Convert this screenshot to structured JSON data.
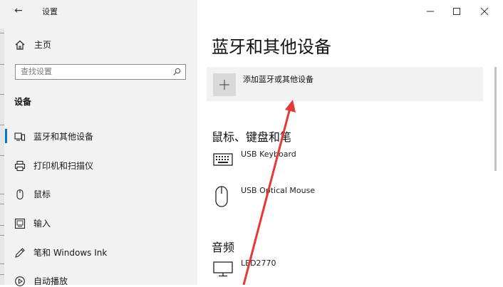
{
  "window": {
    "title": "设置",
    "controls": [
      "minimize-icon",
      "maximize-icon",
      "close-icon"
    ]
  },
  "sidebar": {
    "home_label": "主页",
    "search": {
      "placeholder": "查找设置",
      "icon": "search-icon"
    },
    "section_title": "设备",
    "items": [
      {
        "label": "蓝牙和其他设备",
        "icon": "bluetooth-devices-icon",
        "active": true
      },
      {
        "label": "打印机和扫描仪",
        "icon": "printer-icon",
        "active": false
      },
      {
        "label": "鼠标",
        "icon": "mouse-icon",
        "active": false
      },
      {
        "label": "输入",
        "icon": "keyboard-icon",
        "active": false
      },
      {
        "label": "笔和 Windows Ink",
        "icon": "pen-icon",
        "active": false
      },
      {
        "label": "自动播放",
        "icon": "autoplay-icon",
        "active": false
      }
    ]
  },
  "main": {
    "title": "蓝牙和其他设备",
    "add_device_label": "添加蓝牙或其他设备",
    "groups": [
      {
        "title": "鼠标、键盘和笔",
        "devices": [
          {
            "name": "USB Keyboard",
            "icon": "keyboard-icon"
          },
          {
            "name": "USB Optical Mouse",
            "icon": "mouse-icon"
          }
        ]
      },
      {
        "title": "音频",
        "devices": [
          {
            "name": "LED2770",
            "icon": "monitor-icon"
          }
        ]
      }
    ]
  },
  "colors": {
    "accent": "#0078d4",
    "annotation_arrow": "#e53935",
    "sidebar_bg": "#f2f2f2",
    "main_bg": "#ffffff"
  }
}
